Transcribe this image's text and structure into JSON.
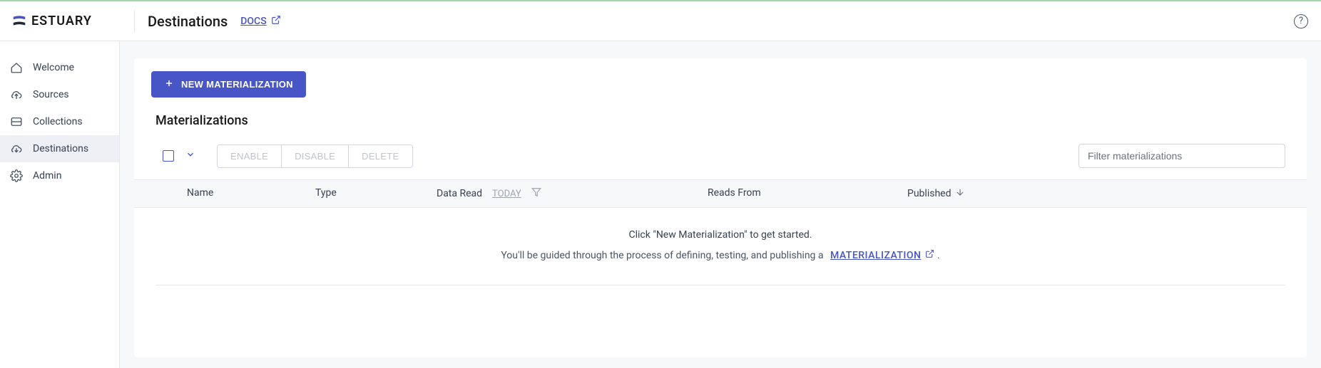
{
  "brand": "ESTUARY",
  "header": {
    "title": "Destinations",
    "docs_label": "DOCS"
  },
  "sidebar": {
    "items": [
      {
        "label": "Welcome"
      },
      {
        "label": "Sources"
      },
      {
        "label": "Collections"
      },
      {
        "label": "Destinations"
      },
      {
        "label": "Admin"
      }
    ]
  },
  "main": {
    "new_button": "NEW MATERIALIZATION",
    "section_title": "Materializations",
    "actions": {
      "enable": "ENABLE",
      "disable": "DISABLE",
      "delete": "DELETE"
    },
    "filter_placeholder": "Filter materializations",
    "columns": {
      "name": "Name",
      "type": "Type",
      "data_read": "Data Read",
      "data_read_period": "TODAY",
      "reads_from": "Reads From",
      "published": "Published"
    },
    "empty": {
      "title": "Click \"New Materialization\" to get started.",
      "desc_prefix": "You'll be guided through the process of defining, testing, and publishing a",
      "link_label": "MATERIALIZATION",
      "desc_suffix": "."
    }
  }
}
